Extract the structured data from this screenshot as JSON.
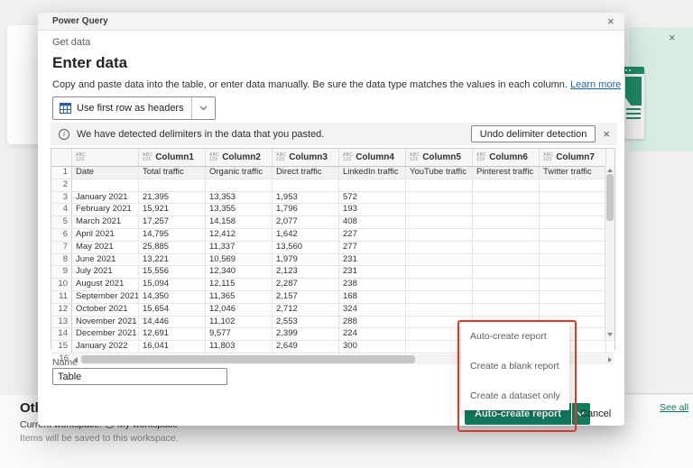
{
  "window": {
    "title": "Power Query",
    "close_icon": "×"
  },
  "breadcrumb": {
    "back_link": "Get data"
  },
  "page": {
    "title": "Enter data",
    "description": "Copy and paste data into the table, or enter data manually. Be sure the data type matches the values in each column. ",
    "learn_more": "Learn more"
  },
  "toolbar": {
    "use_first_row_button": "Use first row as headers"
  },
  "banner": {
    "message": "We have detected delimiters in the data that you pasted.",
    "undo_button": "Undo delimiter detection",
    "close_icon": "×"
  },
  "grid": {
    "type_mark": {
      "top": "ABC",
      "bottom": "123"
    },
    "headers": [
      "",
      "Column1",
      "Column2",
      "Column3",
      "Column4",
      "Column5",
      "Column6",
      "Column7"
    ],
    "rows": [
      {
        "n": "1",
        "cells": [
          "Date",
          "Total traffic",
          "Organic traffic",
          "Direct traffic",
          "LinkedIn traffic",
          "YouTube traffic",
          "Pinterest traffic",
          "Twitter traffic"
        ]
      },
      {
        "n": "2",
        "cells": [
          "",
          "",
          "",
          "",
          "",
          "",
          "",
          ""
        ]
      },
      {
        "n": "3",
        "cells": [
          "January 2021",
          "21,395",
          "13,353",
          "1,953",
          "572",
          "",
          "",
          ""
        ]
      },
      {
        "n": "4",
        "cells": [
          "February 2021",
          "15,921",
          "13,355",
          "1,796",
          "193",
          "",
          "",
          ""
        ]
      },
      {
        "n": "5",
        "cells": [
          "March 2021",
          "17,257",
          "14,158",
          "2,077",
          "408",
          "",
          "",
          ""
        ]
      },
      {
        "n": "6",
        "cells": [
          "April 2021",
          "14,795",
          "12,412",
          "1,642",
          "227",
          "",
          "",
          ""
        ]
      },
      {
        "n": "7",
        "cells": [
          "May 2021",
          "25,885",
          "11,337",
          "13,560",
          "277",
          "",
          "",
          ""
        ]
      },
      {
        "n": "8",
        "cells": [
          "June 2021",
          "13,221",
          "10,569",
          "1,979",
          "231",
          "",
          "",
          ""
        ]
      },
      {
        "n": "9",
        "cells": [
          "July 2021",
          "15,556",
          "12,340",
          "2,123",
          "231",
          "",
          "",
          ""
        ]
      },
      {
        "n": "10",
        "cells": [
          "August 2021",
          "15,094",
          "12,115",
          "2,287",
          "238",
          "",
          "",
          ""
        ]
      },
      {
        "n": "11",
        "cells": [
          "September 2021",
          "14,350",
          "11,365",
          "2,157",
          "168",
          "",
          "",
          ""
        ]
      },
      {
        "n": "12",
        "cells": [
          "October 2021",
          "15,654",
          "12,046",
          "2,712",
          "324",
          "",
          "",
          ""
        ]
      },
      {
        "n": "13",
        "cells": [
          "November 2021",
          "14,446",
          "11,102",
          "2,553",
          "288",
          "",
          "",
          ""
        ]
      },
      {
        "n": "14",
        "cells": [
          "December 2021",
          "12,691",
          "9,577",
          "2,399",
          "224",
          "",
          "",
          ""
        ]
      },
      {
        "n": "15",
        "cells": [
          "January 2022",
          "16,041",
          "11,803",
          "2,649",
          "300",
          "",
          "",
          ""
        ]
      }
    ],
    "scroll_row_number": "16"
  },
  "name_field": {
    "label": "Name",
    "value": "Table"
  },
  "footer": {
    "primary_button": "Auto-create report",
    "cancel_button": "Cancel"
  },
  "menu": {
    "items": [
      "Auto-create report",
      "Create a blank report",
      "Create a dataset only"
    ]
  },
  "background_page": {
    "heading_fragment": "Oth",
    "workspace_prefix": "Current workspace:",
    "workspace_name": "My workspace",
    "note": "Items will be saved to this workspace.",
    "see_all_link": "See all",
    "card_close_icon": "×"
  },
  "colors": {
    "accent_green": "#117a5f",
    "annotation_red": "#d93a2d",
    "mint_card": "#d8eee3",
    "link_blue": "#2266aa",
    "teal_link": "#117865"
  }
}
